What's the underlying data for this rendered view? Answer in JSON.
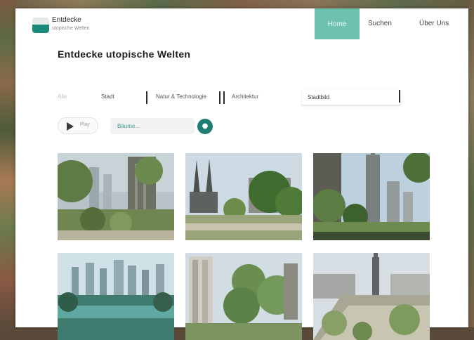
{
  "header": {
    "logo_title": "Entdecke",
    "logo_subtitle": "utopische Welten",
    "nav": [
      {
        "label": "Home",
        "active": true
      },
      {
        "label": "Suchen",
        "active": false
      },
      {
        "label": "Über Uns",
        "active": false
      }
    ]
  },
  "page_title": "Entdecke utopische Welten",
  "filters": {
    "all_label": "Alle",
    "chips": [
      "Stadt",
      "Natur & Technologie",
      "Architektur"
    ],
    "input_value": "Stadtbild"
  },
  "controls": {
    "play_label": "Play",
    "prompt_value": "Bäume...",
    "go_icon": "search-icon"
  },
  "gallery": {
    "tiles": [
      {
        "name": "tile-1",
        "theme": "green-tower"
      },
      {
        "name": "tile-2",
        "theme": "cathedral-park"
      },
      {
        "name": "tile-3",
        "theme": "skyscraper-park"
      },
      {
        "name": "tile-4",
        "theme": "river-city"
      },
      {
        "name": "tile-5",
        "theme": "tree-tower"
      },
      {
        "name": "tile-6",
        "theme": "plaza-tower"
      }
    ]
  },
  "colors": {
    "accent": "#6fc1b0",
    "accent_dark": "#1f7e73",
    "text": "#1e1e1e"
  }
}
